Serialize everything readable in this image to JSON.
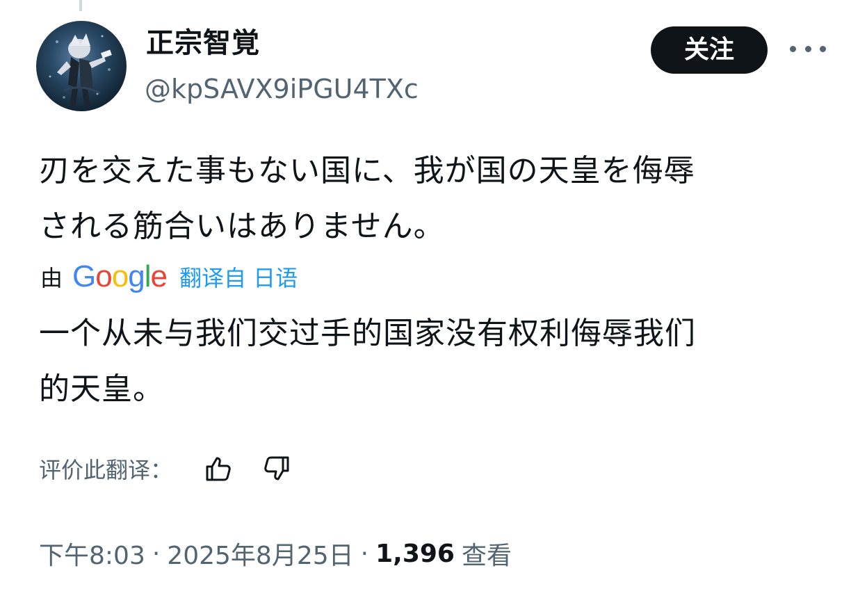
{
  "author": {
    "display_name": "正宗智覚",
    "handle": "@kpSAVX9iPGU4TXc",
    "avatar_icon": "anime-character-avatar"
  },
  "actions": {
    "follow_label": "关注",
    "more_icon": "more-horizontal-icon"
  },
  "tweet": {
    "text_line_1": "刃を交えた事もない国に、我が国の天皇を侮辱",
    "text_line_2": "される筋合いはありません。"
  },
  "translation": {
    "by_label": "由",
    "provider": "Google",
    "from_label": "翻译自 日语",
    "text_line_1": "一个从未与我们交过手的国家没有权利侮辱我们",
    "text_line_2": "的天皇。",
    "rate_label": "评价此翻译：",
    "thumbs_up_icon": "thumbs-up-icon",
    "thumbs_down_icon": "thumbs-down-icon"
  },
  "meta": {
    "time": "下午8:03",
    "separator": "·",
    "date": "2025年8月25日",
    "views_count": "1,396",
    "views_label": "查看"
  },
  "colors": {
    "text_primary": "#0f1419",
    "text_secondary": "#536471",
    "link_blue": "#1d9bf0",
    "button_bg": "#0f1419"
  }
}
